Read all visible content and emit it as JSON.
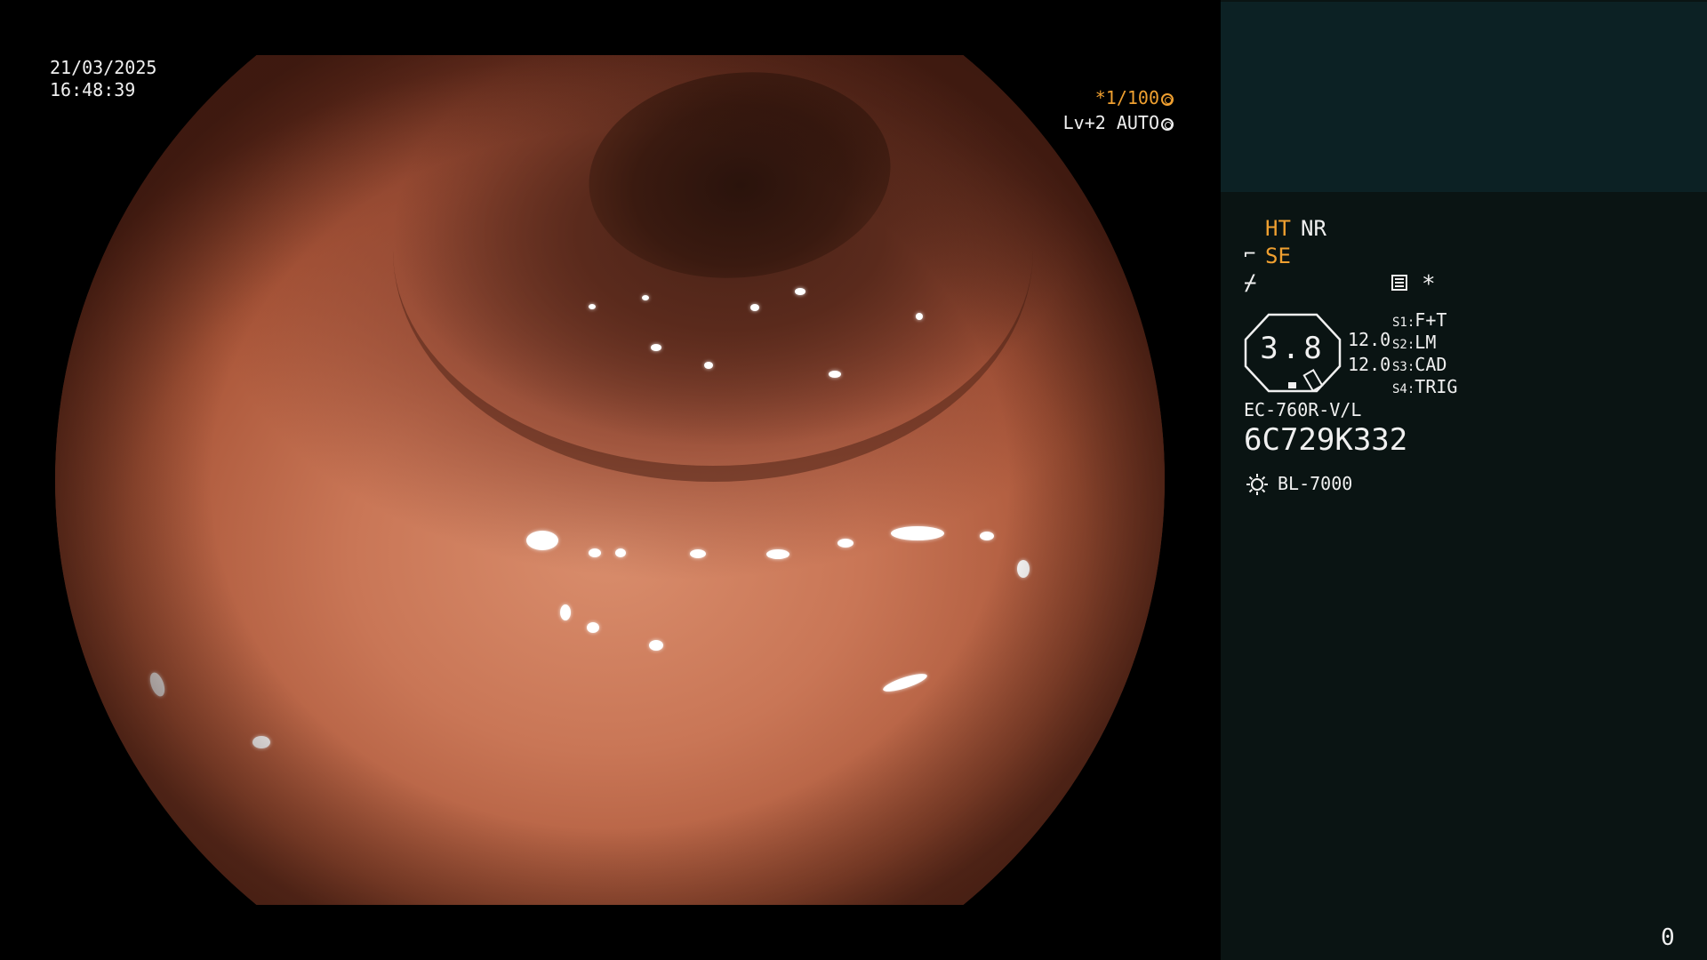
{
  "video": {
    "date": "21/03/2025",
    "time": "16:48:39",
    "shutter": "*1/100",
    "level": "Lv+2 AUTO"
  },
  "panel": {
    "ht": "HT",
    "nr": "NR",
    "se": "SE",
    "star": "*",
    "zoom_value": "3.8",
    "value_1": "12.0",
    "value_2": "12.0",
    "switches": [
      {
        "key": "S1",
        "value": "F+T"
      },
      {
        "key": "S2",
        "value": "LM"
      },
      {
        "key": "S3",
        "value": "CAD"
      },
      {
        "key": "S4",
        "value": "TRIG"
      }
    ],
    "scope_model": "EC-760R-V/L",
    "serial": "6C729K332",
    "light_source": "BL-7000",
    "counter": "0"
  },
  "colors": {
    "accent": "#f0a030",
    "panel_top": "#0c2124",
    "panel_bg": "#0a1413"
  },
  "icons": [
    "shutter-icon",
    "auto-icon",
    "scope-icon",
    "lightning-icon",
    "menu-icon",
    "sun-icon"
  ]
}
